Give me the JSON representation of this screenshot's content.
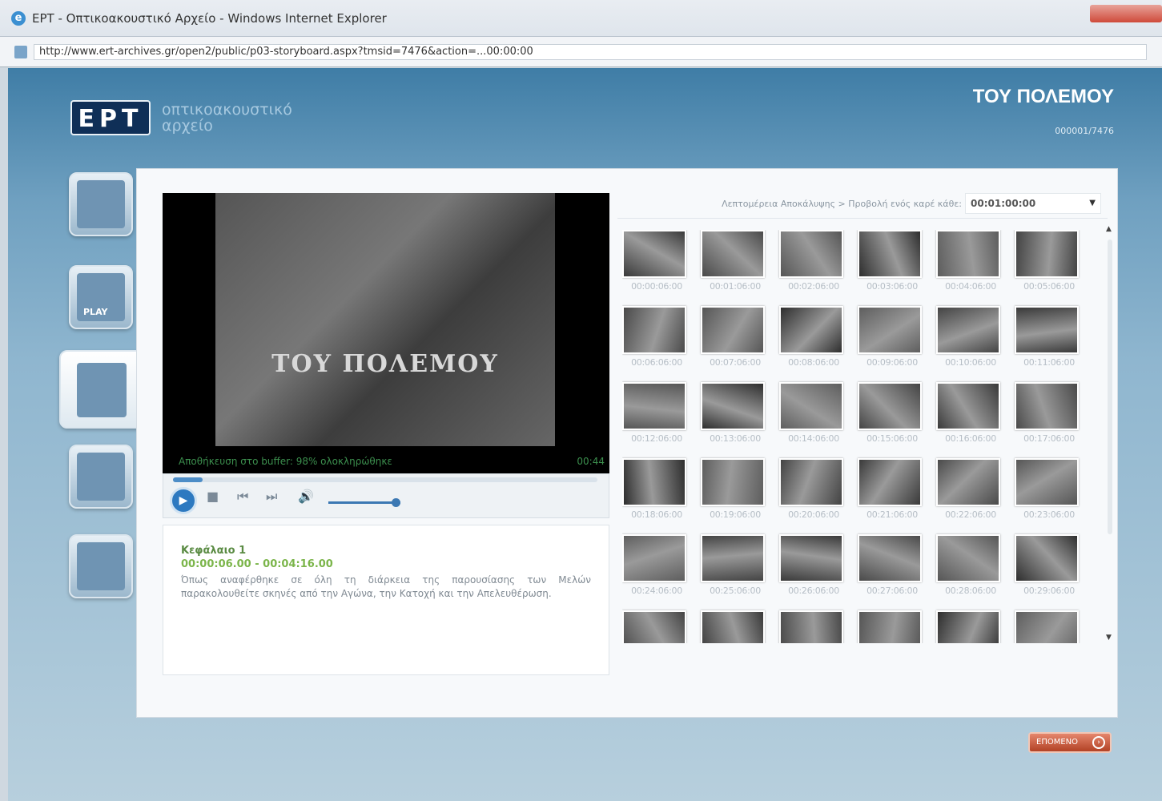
{
  "window": {
    "title": "ΕΡΤ - Οπτικοακουστικό Αρχείο - Windows Internet Explorer",
    "url": "http://www.ert-archives.gr/open2/public/p03-storyboard.aspx?tmsid=7476&action=...00:00:00"
  },
  "header": {
    "logo_text": "ΕΡΤ",
    "logo_sub1": "οπτικοακουστικό",
    "logo_sub2": "αρχείο",
    "title": "ΤΟΥ ΠΟΛΕΜΟΥ",
    "code": "000001/7476"
  },
  "nav": {
    "play_label": "PLAY"
  },
  "player": {
    "overlay_text": "ΤΟΥ ΠΟΛΕΜΟΥ",
    "buffer_text": "Αποθήκευση στο buffer: 98% ολοκληρώθηκε",
    "time": "00:44",
    "progress_fraction": 0.07,
    "volume_fraction": 0.8
  },
  "chapter": {
    "title": "Κεφάλαιο 1",
    "time": "00:00:06.00 - 00:04:16.00",
    "description": "Όπως αναφέρθηκε σε όλη τη διάρκεια της παρουσίασης των Μελών παρακολουθείτε σκηνές από την Αγώνα, την Κατοχή και την Απελευθέρωση."
  },
  "filter": {
    "label": "Λεπτομέρεια Αποκάλυψης > Προβολή ενός καρέ κάθε:",
    "value": "00:01:00:00"
  },
  "thumbnails": [
    "00:00:06:00",
    "00:01:06:00",
    "00:02:06:00",
    "00:03:06:00",
    "00:04:06:00",
    "00:05:06:00",
    "00:06:06:00",
    "00:07:06:00",
    "00:08:06:00",
    "00:09:06:00",
    "00:10:06:00",
    "00:11:06:00",
    "00:12:06:00",
    "00:13:06:00",
    "00:14:06:00",
    "00:15:06:00",
    "00:16:06:00",
    "00:17:06:00",
    "00:18:06:00",
    "00:19:06:00",
    "00:20:06:00",
    "00:21:06:00",
    "00:22:06:00",
    "00:23:06:00",
    "00:24:06:00",
    "00:25:06:00",
    "00:26:06:00",
    "00:27:06:00",
    "00:28:06:00",
    "00:29:06:00",
    "",
    "",
    "",
    "",
    "",
    ""
  ],
  "next_button": "ΕΠΟΜΕΝΟ",
  "colors": {
    "brand": "#0f2f57",
    "accent": "#2d79c0",
    "timecode": "#7bb54a",
    "next_button": "#c0502f"
  }
}
